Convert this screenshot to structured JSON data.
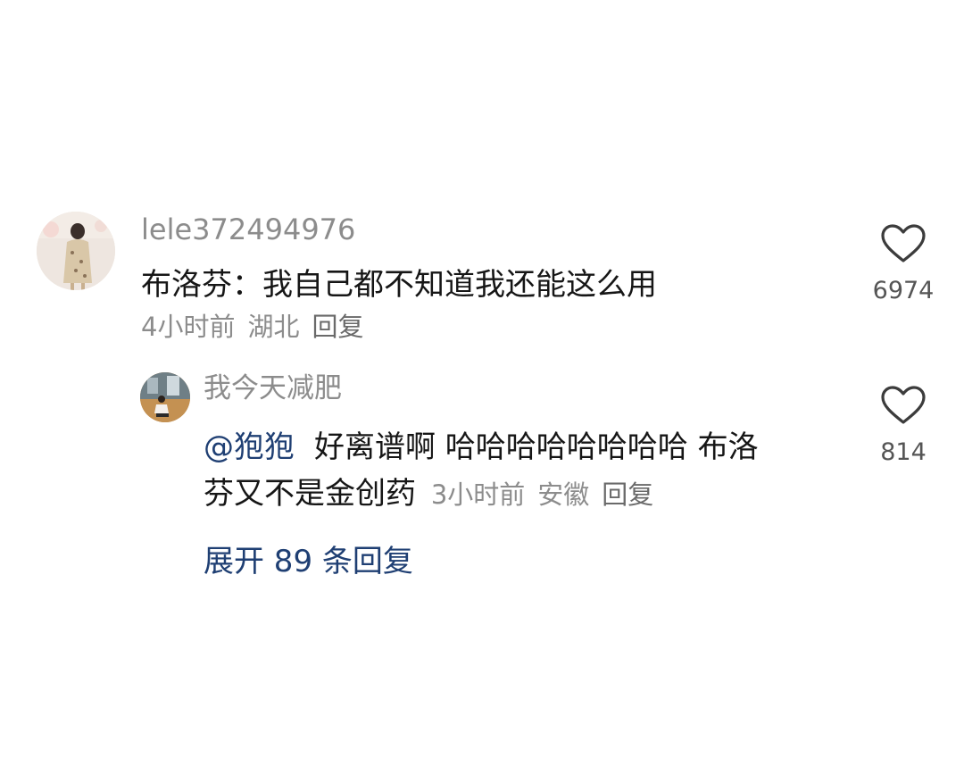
{
  "comment": {
    "username": "lele372494976",
    "text": "布洛芬：我自己都不知道我还能这么用",
    "time": "4小时前",
    "location": "湖北",
    "reply_label": "回复",
    "like_icon": "heart-outline-icon",
    "like_count": "6974"
  },
  "reply": {
    "username": "我今天减肥",
    "mention": "@狍狍",
    "text_line1": "好离谱啊 哈哈哈哈哈哈哈哈 布洛",
    "text_line2": "芬又不是金创药",
    "time": "3小时前",
    "location": "安徽",
    "reply_label": "回复",
    "like_icon": "heart-outline-icon",
    "like_count": "814"
  },
  "expand_replies": "展开 89 条回复",
  "colors": {
    "meta_gray": "#8c8c8c",
    "text_dark": "#161616",
    "link_blue": "#1f3f73"
  }
}
